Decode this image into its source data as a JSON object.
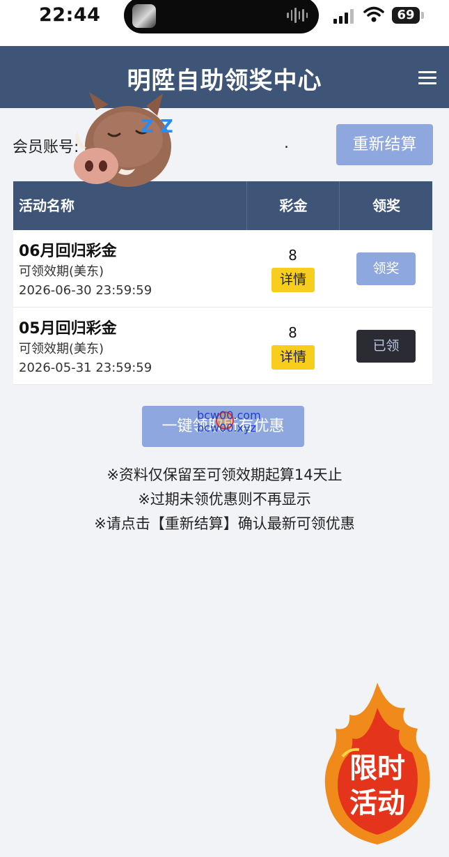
{
  "status_bar": {
    "time": "22:44",
    "battery": "69"
  },
  "header": {
    "title": "明陞自助领奖中心"
  },
  "account": {
    "label": "会员账号:",
    "value": "."
  },
  "buttons": {
    "recalculate": "重新结算",
    "one_click": "一键领取所有优惠"
  },
  "table": {
    "columns": [
      "活动名称",
      "彩金",
      "领奖"
    ],
    "rows": [
      {
        "name": "06月回归彩金",
        "validity": "可领效期(美东)",
        "date": "2026-06-30 23:59:59",
        "amount": "8",
        "detail": "详情",
        "action": "领奖",
        "state": "available"
      },
      {
        "name": "05月回归彩金",
        "validity": "可领效期(美东)",
        "date": "2026-05-31 23:59:59",
        "amount": "8",
        "detail": "详情",
        "action": "已领",
        "state": "claimed"
      }
    ]
  },
  "watermark": {
    "line1": "bcw00.com",
    "line2": "bcw00.xyz"
  },
  "notes": [
    "※资料仅保留至可领效期起算14天止",
    "※过期未领优惠则不再显示",
    "※请点击【重新结算】确认最新可领优惠"
  ],
  "promo": {
    "line1": "限时",
    "line2": "活动"
  },
  "sticker": {
    "zzz": "Z Z Z"
  },
  "colors": {
    "header": "#3e5577",
    "button": "#8ea8df",
    "detail": "#f7ce1e",
    "claimed": "#2b2c33",
    "background": "#f2f3f6"
  }
}
